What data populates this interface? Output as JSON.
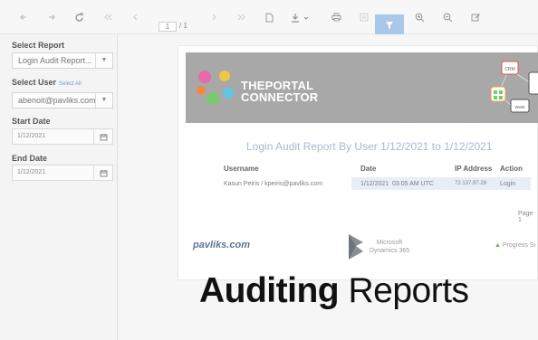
{
  "toolbar": {
    "page_current": "1",
    "page_total": "/ 1",
    "buttons": [
      "back-icon",
      "forward-icon",
      "refresh-icon",
      "first-page-icon",
      "prev-page-icon",
      "next-page-icon",
      "last-page-icon",
      "document-icon",
      "export-icon",
      "print-icon",
      "print-preview-icon",
      "filter-icon",
      "zoom-in-icon",
      "zoom-out-icon",
      "edit-icon"
    ],
    "accent_color": "#a9c7e8"
  },
  "sidebar": {
    "report_label": "Select Report",
    "report_value": "Login Audit Report...",
    "user_label": "Select User",
    "user_select_all": "Select All",
    "user_value": "abenoit@pavliks.com",
    "start_label": "Start Date",
    "start_value": "1/12/2021",
    "end_label": "End Date",
    "end_value": "1/12/2021"
  },
  "report": {
    "brand_line1": "THEPORTAL",
    "brand_line2": "CONNECTOR",
    "banner_tags": [
      "CRM",
      "www"
    ],
    "title": "Login Audit Report By User 1/12/2021 to 1/12/2021",
    "columns": [
      "Username",
      "Date",
      "IP Address",
      "Action"
    ],
    "rows": [
      {
        "username": "Kasun Peiris / kpeiris@pavliks.com",
        "date": "1/12/2021  03:05 AM UTC",
        "ip": "72.137.97.29",
        "action": "Login"
      }
    ],
    "page_label": "Page 1",
    "footer_pavliks": "pavliks.com",
    "footer_ms_line1": "Microsoft",
    "footer_ms_line2": "Dynamics 365",
    "footer_progress": "Progress Si"
  },
  "caption": {
    "bold": "Auditing",
    "light": "Reports"
  }
}
